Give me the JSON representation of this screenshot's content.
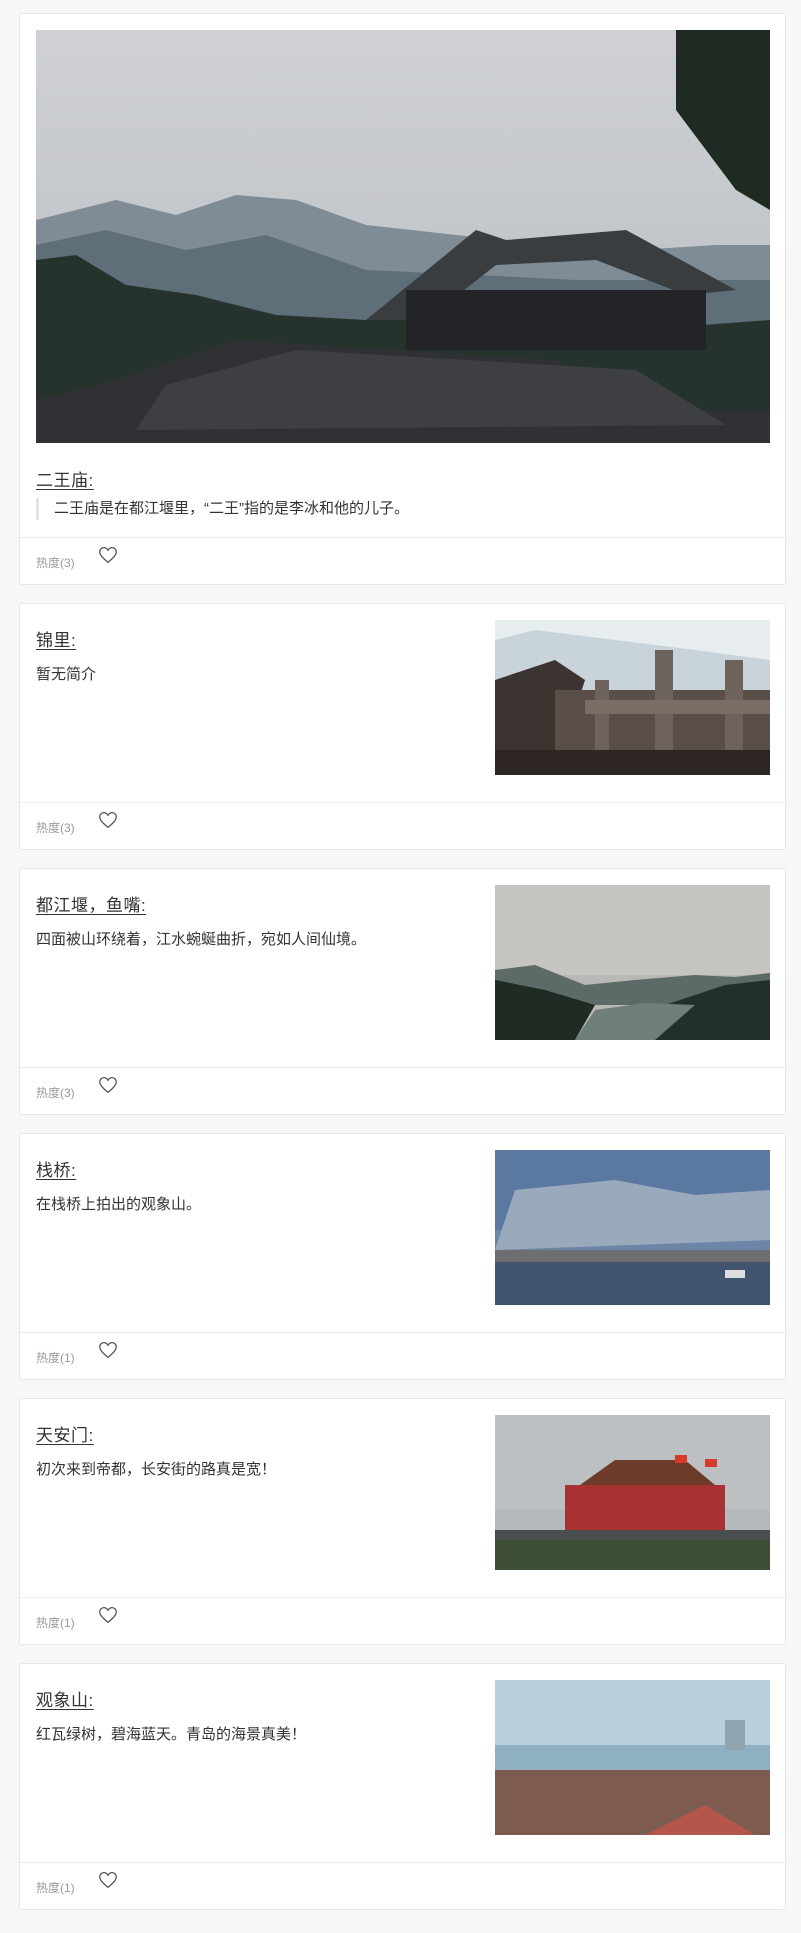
{
  "posts": [
    {
      "title": "二王庙:",
      "desc": "二王庙是在都江堰里，“二王”指的是李冰和他的儿子。",
      "heat_label": "热度",
      "heat": "(3)"
    },
    {
      "title": "锦里:",
      "desc": "暂无简介",
      "heat_label": "热度",
      "heat": "(3)"
    },
    {
      "title": "都江堰，鱼嘴:",
      "desc": "四面被山环绕着，江水蜿蜒曲折，宛如人间仙境。",
      "heat_label": "热度",
      "heat": "(3)"
    },
    {
      "title": "栈桥:",
      "desc": "在栈桥上拍出的观象山。",
      "heat_label": "热度",
      "heat": "(1)"
    },
    {
      "title": "天安门:",
      "desc": "初次来到帝都，长安街的路真是宽！",
      "heat_label": "热度",
      "heat": "(1)"
    },
    {
      "title": "观象山:",
      "desc": "红瓦绿树，碧海蓝天。青岛的海景真美！",
      "heat_label": "热度",
      "heat": "(1)"
    }
  ],
  "icons": {
    "like": "heart-outline-icon"
  },
  "colors": {
    "background": "#f7f7f7",
    "card": "#ffffff",
    "border": "#e6e6e6",
    "muted": "#9a9a9a",
    "text": "#333333"
  }
}
